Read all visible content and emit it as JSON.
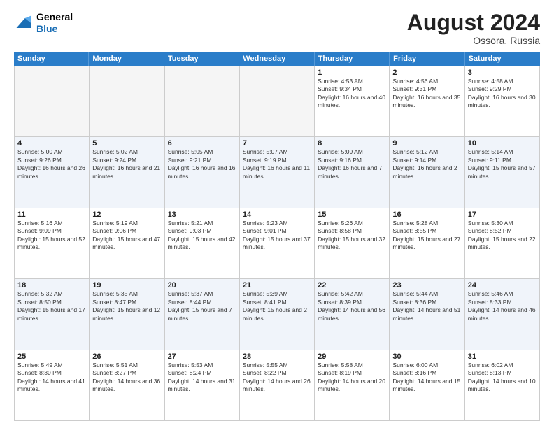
{
  "header": {
    "logo": {
      "general": "General",
      "blue": "Blue"
    },
    "month_year": "August 2024",
    "location": "Ossora, Russia"
  },
  "days_of_week": [
    "Sunday",
    "Monday",
    "Tuesday",
    "Wednesday",
    "Thursday",
    "Friday",
    "Saturday"
  ],
  "rows": [
    [
      {
        "day": "",
        "empty": true
      },
      {
        "day": "",
        "empty": true
      },
      {
        "day": "",
        "empty": true
      },
      {
        "day": "",
        "empty": true
      },
      {
        "day": "1",
        "sunrise": "4:53 AM",
        "sunset": "9:34 PM",
        "daylight": "16 hours and 40 minutes."
      },
      {
        "day": "2",
        "sunrise": "4:56 AM",
        "sunset": "9:31 PM",
        "daylight": "16 hours and 35 minutes."
      },
      {
        "day": "3",
        "sunrise": "4:58 AM",
        "sunset": "9:29 PM",
        "daylight": "16 hours and 30 minutes."
      }
    ],
    [
      {
        "day": "4",
        "sunrise": "5:00 AM",
        "sunset": "9:26 PM",
        "daylight": "16 hours and 26 minutes."
      },
      {
        "day": "5",
        "sunrise": "5:02 AM",
        "sunset": "9:24 PM",
        "daylight": "16 hours and 21 minutes."
      },
      {
        "day": "6",
        "sunrise": "5:05 AM",
        "sunset": "9:21 PM",
        "daylight": "16 hours and 16 minutes."
      },
      {
        "day": "7",
        "sunrise": "5:07 AM",
        "sunset": "9:19 PM",
        "daylight": "16 hours and 11 minutes."
      },
      {
        "day": "8",
        "sunrise": "5:09 AM",
        "sunset": "9:16 PM",
        "daylight": "16 hours and 7 minutes."
      },
      {
        "day": "9",
        "sunrise": "5:12 AM",
        "sunset": "9:14 PM",
        "daylight": "16 hours and 2 minutes."
      },
      {
        "day": "10",
        "sunrise": "5:14 AM",
        "sunset": "9:11 PM",
        "daylight": "15 hours and 57 minutes."
      }
    ],
    [
      {
        "day": "11",
        "sunrise": "5:16 AM",
        "sunset": "9:09 PM",
        "daylight": "15 hours and 52 minutes."
      },
      {
        "day": "12",
        "sunrise": "5:19 AM",
        "sunset": "9:06 PM",
        "daylight": "15 hours and 47 minutes."
      },
      {
        "day": "13",
        "sunrise": "5:21 AM",
        "sunset": "9:03 PM",
        "daylight": "15 hours and 42 minutes."
      },
      {
        "day": "14",
        "sunrise": "5:23 AM",
        "sunset": "9:01 PM",
        "daylight": "15 hours and 37 minutes."
      },
      {
        "day": "15",
        "sunrise": "5:26 AM",
        "sunset": "8:58 PM",
        "daylight": "15 hours and 32 minutes."
      },
      {
        "day": "16",
        "sunrise": "5:28 AM",
        "sunset": "8:55 PM",
        "daylight": "15 hours and 27 minutes."
      },
      {
        "day": "17",
        "sunrise": "5:30 AM",
        "sunset": "8:52 PM",
        "daylight": "15 hours and 22 minutes."
      }
    ],
    [
      {
        "day": "18",
        "sunrise": "5:32 AM",
        "sunset": "8:50 PM",
        "daylight": "15 hours and 17 minutes."
      },
      {
        "day": "19",
        "sunrise": "5:35 AM",
        "sunset": "8:47 PM",
        "daylight": "15 hours and 12 minutes."
      },
      {
        "day": "20",
        "sunrise": "5:37 AM",
        "sunset": "8:44 PM",
        "daylight": "15 hours and 7 minutes."
      },
      {
        "day": "21",
        "sunrise": "5:39 AM",
        "sunset": "8:41 PM",
        "daylight": "15 hours and 2 minutes."
      },
      {
        "day": "22",
        "sunrise": "5:42 AM",
        "sunset": "8:39 PM",
        "daylight": "14 hours and 56 minutes."
      },
      {
        "day": "23",
        "sunrise": "5:44 AM",
        "sunset": "8:36 PM",
        "daylight": "14 hours and 51 minutes."
      },
      {
        "day": "24",
        "sunrise": "5:46 AM",
        "sunset": "8:33 PM",
        "daylight": "14 hours and 46 minutes."
      }
    ],
    [
      {
        "day": "25",
        "sunrise": "5:49 AM",
        "sunset": "8:30 PM",
        "daylight": "14 hours and 41 minutes."
      },
      {
        "day": "26",
        "sunrise": "5:51 AM",
        "sunset": "8:27 PM",
        "daylight": "14 hours and 36 minutes."
      },
      {
        "day": "27",
        "sunrise": "5:53 AM",
        "sunset": "8:24 PM",
        "daylight": "14 hours and 31 minutes."
      },
      {
        "day": "28",
        "sunrise": "5:55 AM",
        "sunset": "8:22 PM",
        "daylight": "14 hours and 26 minutes."
      },
      {
        "day": "29",
        "sunrise": "5:58 AM",
        "sunset": "8:19 PM",
        "daylight": "14 hours and 20 minutes."
      },
      {
        "day": "30",
        "sunrise": "6:00 AM",
        "sunset": "8:16 PM",
        "daylight": "14 hours and 15 minutes."
      },
      {
        "day": "31",
        "sunrise": "6:02 AM",
        "sunset": "8:13 PM",
        "daylight": "14 hours and 10 minutes."
      }
    ]
  ]
}
